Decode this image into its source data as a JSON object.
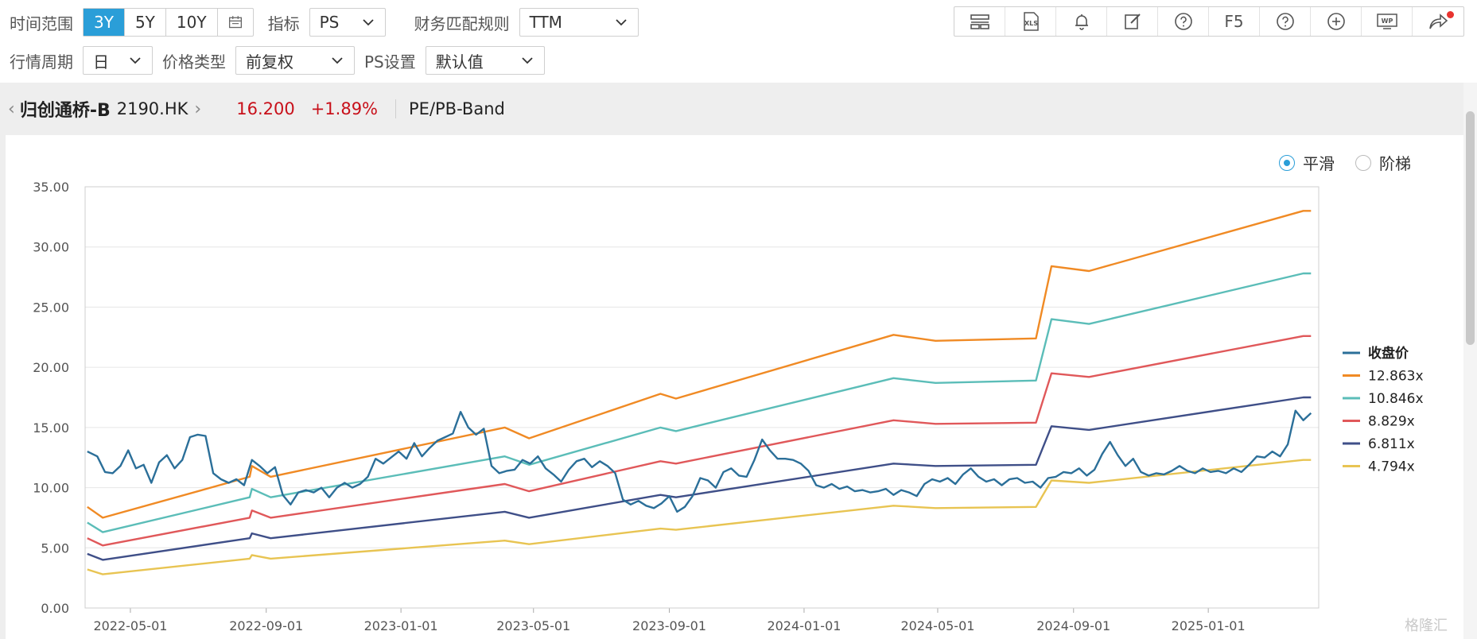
{
  "toolbar": {
    "time_range_label": "时间范围",
    "ranges": [
      "3Y",
      "5Y",
      "10Y"
    ],
    "indicator_label": "指标",
    "indicator_value": "PS",
    "fin_rule_label": "财务匹配规则",
    "fin_rule_value": "TTM",
    "period_label": "行情周期",
    "period_value": "日",
    "price_type_label": "价格类型",
    "price_type_value": "前复权",
    "ps_setting_label": "PS设置",
    "ps_setting_value": "默认值",
    "tool_icons": [
      "layout-icon",
      "xls-export-icon",
      "bell-icon",
      "edit-icon",
      "help-icon",
      "refresh-f5",
      "question-icon",
      "add-icon",
      "wp-icon",
      "share-icon"
    ],
    "f5_label": "F5",
    "xls_label": "XLS",
    "wp_label": "WP"
  },
  "stock": {
    "name": "归创通桥-B",
    "code": "2190.HK",
    "price": "16.200",
    "change": "+1.89%",
    "band_type": "PE/PB-Band"
  },
  "mode": {
    "smooth_label": "平滑",
    "step_label": "阶梯",
    "selected": "smooth"
  },
  "watermark": "格隆汇",
  "colors": {
    "accent": "#2a9ed8",
    "price_red": "#c8101a",
    "close": "#2b6f99",
    "s1": "#f08a24",
    "s2": "#5bbdb8",
    "s3": "#e0585a",
    "s4": "#3f4f88",
    "s5": "#e8c452"
  },
  "chart_data": {
    "type": "line",
    "title": "",
    "xlabel": "",
    "ylabel": "",
    "ylim": [
      0,
      35
    ],
    "yticks": [
      "0.00",
      "5.00",
      "10.00",
      "15.00",
      "20.00",
      "25.00",
      "30.00",
      "35.00"
    ],
    "xlim": [
      "2022-03-21",
      "2025-04-11"
    ],
    "xticks": [
      "2022-05-01",
      "2022-09-01",
      "2023-01-01",
      "2023-05-01",
      "2023-09-01",
      "2024-01-01",
      "2024-05-01",
      "2024-09-01",
      "2025-01-01"
    ],
    "grid": true,
    "legend_position": "right",
    "bands_x": [
      "2022-03-23",
      "2022-04-06",
      "2022-08-17",
      "2022-08-19",
      "2022-09-05",
      "2023-04-05",
      "2023-04-27",
      "2023-08-24",
      "2023-09-07",
      "2024-03-22",
      "2024-04-29",
      "2024-07-29",
      "2024-08-12",
      "2024-09-15",
      "2025-03-28",
      "2025-04-04"
    ],
    "series": [
      {
        "name": "收盘价",
        "values": [
          [
            "2022-03-23",
            13.0
          ],
          [
            "2022-04-01",
            12.6
          ],
          [
            "2022-04-08",
            11.3
          ],
          [
            "2022-04-15",
            11.2
          ],
          [
            "2022-04-22",
            11.8
          ],
          [
            "2022-04-29",
            13.1
          ],
          [
            "2022-05-06",
            11.6
          ],
          [
            "2022-05-13",
            11.9
          ],
          [
            "2022-05-20",
            10.4
          ],
          [
            "2022-05-27",
            12.1
          ],
          [
            "2022-06-03",
            12.7
          ],
          [
            "2022-06-10",
            11.6
          ],
          [
            "2022-06-17",
            12.3
          ],
          [
            "2022-06-24",
            14.2
          ],
          [
            "2022-07-01",
            14.4
          ],
          [
            "2022-07-08",
            14.3
          ],
          [
            "2022-07-15",
            11.2
          ],
          [
            "2022-07-22",
            10.7
          ],
          [
            "2022-07-29",
            10.4
          ],
          [
            "2022-08-05",
            10.7
          ],
          [
            "2022-08-12",
            10.2
          ],
          [
            "2022-08-19",
            12.3
          ],
          [
            "2022-08-26",
            11.8
          ],
          [
            "2022-09-02",
            11.2
          ],
          [
            "2022-09-09",
            11.7
          ],
          [
            "2022-09-16",
            9.4
          ],
          [
            "2022-09-23",
            8.6
          ],
          [
            "2022-09-30",
            9.6
          ],
          [
            "2022-10-07",
            9.8
          ],
          [
            "2022-10-14",
            9.6
          ],
          [
            "2022-10-21",
            10.0
          ],
          [
            "2022-10-28",
            9.2
          ],
          [
            "2022-11-04",
            10.0
          ],
          [
            "2022-11-11",
            10.4
          ],
          [
            "2022-11-18",
            10.0
          ],
          [
            "2022-11-25",
            10.3
          ],
          [
            "2022-12-02",
            10.9
          ],
          [
            "2022-12-09",
            12.4
          ],
          [
            "2022-12-16",
            12.0
          ],
          [
            "2022-12-23",
            12.5
          ],
          [
            "2022-12-30",
            13.0
          ],
          [
            "2023-01-06",
            12.4
          ],
          [
            "2023-01-13",
            13.7
          ],
          [
            "2023-01-20",
            12.6
          ],
          [
            "2023-01-27",
            13.3
          ],
          [
            "2023-02-03",
            13.9
          ],
          [
            "2023-02-10",
            14.2
          ],
          [
            "2023-02-17",
            14.5
          ],
          [
            "2023-02-24",
            16.3
          ],
          [
            "2023-03-03",
            15.0
          ],
          [
            "2023-03-10",
            14.4
          ],
          [
            "2023-03-17",
            14.9
          ],
          [
            "2023-03-24",
            11.8
          ],
          [
            "2023-03-31",
            11.2
          ],
          [
            "2023-04-07",
            11.4
          ],
          [
            "2023-04-14",
            11.5
          ],
          [
            "2023-04-21",
            12.3
          ],
          [
            "2023-04-28",
            12.0
          ],
          [
            "2023-05-05",
            12.6
          ],
          [
            "2023-05-12",
            11.6
          ],
          [
            "2023-05-19",
            11.1
          ],
          [
            "2023-05-26",
            10.5
          ],
          [
            "2023-06-02",
            11.5
          ],
          [
            "2023-06-09",
            12.2
          ],
          [
            "2023-06-16",
            12.4
          ],
          [
            "2023-06-23",
            11.7
          ],
          [
            "2023-06-30",
            12.2
          ],
          [
            "2023-07-07",
            11.8
          ],
          [
            "2023-07-14",
            11.2
          ],
          [
            "2023-07-21",
            9.0
          ],
          [
            "2023-07-28",
            8.6
          ],
          [
            "2023-08-04",
            8.9
          ],
          [
            "2023-08-11",
            8.5
          ],
          [
            "2023-08-18",
            8.3
          ],
          [
            "2023-08-25",
            8.7
          ],
          [
            "2023-09-01",
            9.3
          ],
          [
            "2023-09-08",
            8.0
          ],
          [
            "2023-09-15",
            8.4
          ],
          [
            "2023-09-22",
            9.3
          ],
          [
            "2023-09-29",
            10.8
          ],
          [
            "2023-10-06",
            10.6
          ],
          [
            "2023-10-13",
            10.0
          ],
          [
            "2023-10-20",
            11.3
          ],
          [
            "2023-10-27",
            11.6
          ],
          [
            "2023-11-03",
            11.0
          ],
          [
            "2023-11-10",
            10.9
          ],
          [
            "2023-11-17",
            12.3
          ],
          [
            "2023-11-24",
            14.0
          ],
          [
            "2023-12-01",
            13.1
          ],
          [
            "2023-12-08",
            12.4
          ],
          [
            "2023-12-15",
            12.4
          ],
          [
            "2023-12-22",
            12.3
          ],
          [
            "2023-12-29",
            12.0
          ],
          [
            "2024-01-05",
            11.4
          ],
          [
            "2024-01-12",
            10.2
          ],
          [
            "2024-01-19",
            10.0
          ],
          [
            "2024-01-26",
            10.3
          ],
          [
            "2024-02-02",
            9.9
          ],
          [
            "2024-02-09",
            10.1
          ],
          [
            "2024-02-16",
            9.7
          ],
          [
            "2024-02-23",
            9.8
          ],
          [
            "2024-03-01",
            9.6
          ],
          [
            "2024-03-08",
            9.7
          ],
          [
            "2024-03-15",
            9.9
          ],
          [
            "2024-03-22",
            9.4
          ],
          [
            "2024-03-29",
            9.8
          ],
          [
            "2024-04-05",
            9.6
          ],
          [
            "2024-04-12",
            9.3
          ],
          [
            "2024-04-19",
            10.3
          ],
          [
            "2024-04-26",
            10.7
          ],
          [
            "2024-05-03",
            10.5
          ],
          [
            "2024-05-10",
            10.8
          ],
          [
            "2024-05-17",
            10.3
          ],
          [
            "2024-05-24",
            11.1
          ],
          [
            "2024-05-31",
            11.6
          ],
          [
            "2024-06-07",
            10.9
          ],
          [
            "2024-06-14",
            10.5
          ],
          [
            "2024-06-21",
            10.7
          ],
          [
            "2024-06-28",
            10.2
          ],
          [
            "2024-07-05",
            10.7
          ],
          [
            "2024-07-12",
            10.8
          ],
          [
            "2024-07-19",
            10.4
          ],
          [
            "2024-07-26",
            10.5
          ],
          [
            "2024-08-02",
            10.0
          ],
          [
            "2024-08-09",
            10.8
          ],
          [
            "2024-08-16",
            10.9
          ],
          [
            "2024-08-23",
            11.3
          ],
          [
            "2024-08-30",
            11.2
          ],
          [
            "2024-09-06",
            11.6
          ],
          [
            "2024-09-13",
            11.0
          ],
          [
            "2024-09-20",
            11.5
          ],
          [
            "2024-09-27",
            12.8
          ],
          [
            "2024-10-04",
            13.8
          ],
          [
            "2024-10-11",
            12.7
          ],
          [
            "2024-10-18",
            11.8
          ],
          [
            "2024-10-25",
            12.4
          ],
          [
            "2024-11-01",
            11.3
          ],
          [
            "2024-11-08",
            11.0
          ],
          [
            "2024-11-15",
            11.2
          ],
          [
            "2024-11-22",
            11.1
          ],
          [
            "2024-11-29",
            11.4
          ],
          [
            "2024-12-06",
            11.8
          ],
          [
            "2024-12-13",
            11.4
          ],
          [
            "2024-12-20",
            11.2
          ],
          [
            "2024-12-27",
            11.6
          ],
          [
            "2025-01-03",
            11.3
          ],
          [
            "2025-01-10",
            11.4
          ],
          [
            "2025-01-17",
            11.2
          ],
          [
            "2025-01-24",
            11.6
          ],
          [
            "2025-01-31",
            11.3
          ],
          [
            "2025-02-07",
            11.9
          ],
          [
            "2025-02-14",
            12.6
          ],
          [
            "2025-02-21",
            12.5
          ],
          [
            "2025-02-28",
            13.0
          ],
          [
            "2025-03-07",
            12.6
          ],
          [
            "2025-03-14",
            13.6
          ],
          [
            "2025-03-21",
            16.4
          ],
          [
            "2025-03-28",
            15.6
          ],
          [
            "2025-04-04",
            16.2
          ]
        ]
      },
      {
        "name": "12.863x",
        "values": [
          8.4,
          7.5,
          10.9,
          11.8,
          10.9,
          15.0,
          14.1,
          17.8,
          17.4,
          22.7,
          22.2,
          22.4,
          28.4,
          28.0,
          33.0,
          33.0
        ]
      },
      {
        "name": "10.846x",
        "values": [
          7.1,
          6.3,
          9.2,
          9.9,
          9.2,
          12.6,
          11.9,
          15.0,
          14.7,
          19.1,
          18.7,
          18.9,
          24.0,
          23.6,
          27.8,
          27.8
        ]
      },
      {
        "name": "8.829x",
        "values": [
          5.8,
          5.2,
          7.5,
          8.1,
          7.5,
          10.3,
          9.7,
          12.2,
          12.0,
          15.6,
          15.3,
          15.4,
          19.5,
          19.2,
          22.6,
          22.6
        ]
      },
      {
        "name": "6.811x",
        "values": [
          4.5,
          4.0,
          5.8,
          6.2,
          5.8,
          8.0,
          7.5,
          9.4,
          9.2,
          12.0,
          11.8,
          11.9,
          15.1,
          14.8,
          17.5,
          17.5
        ]
      },
      {
        "name": "4.794x",
        "values": [
          3.2,
          2.8,
          4.1,
          4.4,
          4.1,
          5.6,
          5.3,
          6.6,
          6.5,
          8.5,
          8.3,
          8.4,
          10.6,
          10.4,
          12.3,
          12.3
        ]
      }
    ]
  }
}
